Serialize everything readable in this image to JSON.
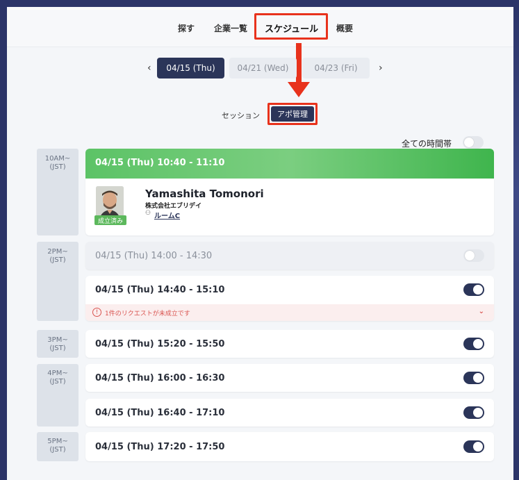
{
  "nav": {
    "items": [
      "探す",
      "企業一覧",
      "スケジュール",
      "概要"
    ]
  },
  "dates": {
    "prev": "‹",
    "next": "›",
    "options": [
      "04/15 (Thu)",
      "04/21 (Wed)",
      "04/23 (Fri)"
    ],
    "selected": "04/15 (Thu)"
  },
  "segment": {
    "session": "セッション",
    "appointment": "アポ管理",
    "selected": "アポ管理"
  },
  "all_time": {
    "label": "全ての時間帯",
    "enabled": false
  },
  "timeline": {
    "groups": [
      {
        "time": "10AM~",
        "tz": "(JST)"
      },
      {
        "time": "2PM~",
        "tz": "(JST)"
      },
      {
        "time": "3PM~",
        "tz": "(JST)"
      },
      {
        "time": "4PM~",
        "tz": "(JST)"
      },
      {
        "time": "5PM~",
        "tz": "(JST)"
      }
    ],
    "booked_slot": {
      "label": "04/15 (Thu) 10:40 - 11:10",
      "person": {
        "name": "Yamashita Tomonori",
        "company": "株式会社エブリデイ",
        "room": "ルームC",
        "status": "成立済み"
      }
    },
    "slots": [
      {
        "label": "04/15 (Thu) 14:00 - 14:30",
        "enabled": false
      },
      {
        "label": "04/15 (Thu) 14:40 - 15:10",
        "enabled": true,
        "warning": "1件のリクエストが未成立です"
      },
      {
        "label": "04/15 (Thu) 15:20 - 15:50",
        "enabled": true
      },
      {
        "label": "04/15 (Thu) 16:00 - 16:30",
        "enabled": true
      },
      {
        "label": "04/15 (Thu) 16:40 - 17:10",
        "enabled": true
      },
      {
        "label": "04/15 (Thu) 17:20 - 17:50",
        "enabled": true
      }
    ]
  },
  "colors": {
    "primary": "#2b3559",
    "highlight": "#e8321c",
    "success": "#5cc366",
    "warning": "#d9534f"
  },
  "icons": {
    "warn": "!",
    "chevron": "⌄",
    "room": "⚇"
  }
}
